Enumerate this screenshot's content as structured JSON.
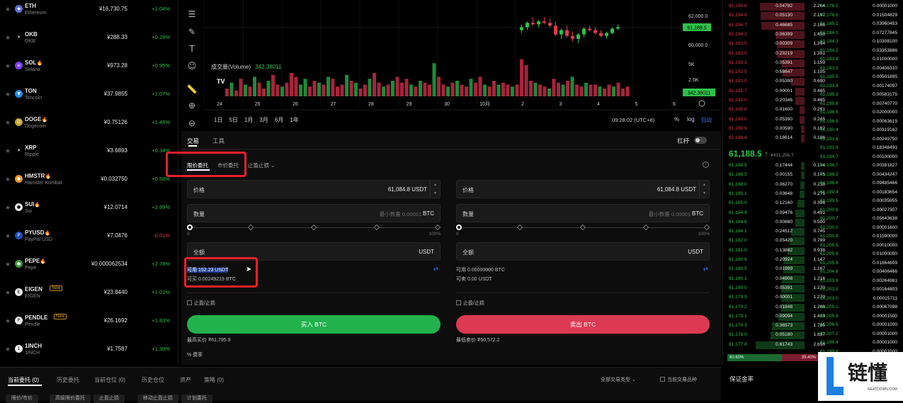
{
  "coins": [
    {
      "sym": "ETH",
      "name": "Ethereum",
      "price": "¥16,730.75",
      "chg": "+1.04%",
      "dir": "up",
      "color": "#5a6fd8",
      "glyph": "◆",
      "fire": false,
      "isnew": false
    },
    {
      "sym": "OKB",
      "name": "OKB",
      "price": "¥288.33",
      "chg": "+0.29%",
      "dir": "up",
      "color": "#000",
      "glyph": "✕",
      "fire": false,
      "isnew": false
    },
    {
      "sym": "SOL",
      "name": "Solana",
      "price": "¥973.28",
      "chg": "+0.95%",
      "dir": "up",
      "color": "#7b3fe4",
      "glyph": "≡",
      "fire": true,
      "isnew": false
    },
    {
      "sym": "TON",
      "name": "Toncoin",
      "price": "¥37.9855",
      "chg": "+1.07%",
      "dir": "up",
      "color": "#1f8ce6",
      "glyph": "▼",
      "fire": false,
      "isnew": false
    },
    {
      "sym": "DOGE",
      "name": "Dogecoin",
      "price": "¥0.75126",
      "chg": "+1.46%",
      "dir": "up",
      "color": "#c2a633",
      "glyph": "D",
      "fire": true,
      "isnew": false
    },
    {
      "sym": "XRP",
      "name": "Ripple",
      "price": "¥3.6893",
      "chg": "+0.34%",
      "dir": "up",
      "color": "#000",
      "glyph": "✕",
      "fire": false,
      "isnew": false
    },
    {
      "sym": "HMSTR",
      "name": "Hamster Kombat",
      "price": "¥0.032750",
      "chg": "+0.50%",
      "dir": "up",
      "color": "#e8952a",
      "glyph": "●",
      "fire": true,
      "isnew": false
    },
    {
      "sym": "SUI",
      "name": "Sui",
      "price": "¥12.0714",
      "chg": "+2.99%",
      "dir": "up",
      "color": "#eaeaea",
      "glyph": "●",
      "fire": true,
      "isnew": false
    },
    {
      "sym": "PYUSD",
      "name": "PayPal USD",
      "price": "¥7.0476",
      "chg": "-0.01%",
      "dir": "dn",
      "color": "#1d4fb8",
      "glyph": "P",
      "fire": true,
      "isnew": false
    },
    {
      "sym": "PEPE",
      "name": "Pepe",
      "price": "¥0.000062534",
      "chg": "+2.78%",
      "dir": "up",
      "color": "#3b9b3b",
      "glyph": "●",
      "fire": true,
      "isnew": false
    },
    {
      "sym": "EIGEN",
      "name": "EIGEN",
      "price": "¥23.8440",
      "chg": "+1.01%",
      "dir": "up",
      "color": "#eaeaea",
      "glyph": "E",
      "fire": false,
      "isnew": true
    },
    {
      "sym": "PENDLE",
      "name": "Pendle",
      "price": "¥26.1692",
      "chg": "+1.83%",
      "dir": "up",
      "color": "#eaeaea",
      "glyph": "P",
      "fire": false,
      "isnew": true
    },
    {
      "sym": "1INCH",
      "name": "1INCH",
      "price": "¥1.7587",
      "chg": "+1.30%",
      "dir": "up",
      "color": "#eaeaea",
      "glyph": "1",
      "fire": false,
      "isnew": false
    }
  ],
  "new_badge": "New",
  "chart": {
    "price_labels": [
      "62,000.0",
      "61,188.5",
      "60,000.0"
    ],
    "current_price": "61,188.5",
    "volume_title": "成交量(Volume)",
    "volume_value": "342.38011",
    "vol_ticks": [
      "5K",
      "2.5K"
    ],
    "vol_current": "342.38011",
    "x_ticks": [
      "24",
      "25",
      "26",
      "27",
      "28",
      "29",
      "30",
      "10月",
      "2",
      "3",
      "4",
      "5",
      "6"
    ],
    "ranges": [
      "1日",
      "5日",
      "1月",
      "3月",
      "6月",
      "1年"
    ],
    "clock": "09:28:02 (UTC+8)",
    "pct_btn": "%",
    "log_btn": "log",
    "auto_btn": "自动",
    "tv_mark": "TV",
    "candles": [
      [
        61000,
        61400,
        60800,
        61200
      ],
      [
        61200,
        61600,
        61000,
        61500
      ],
      [
        61500,
        61900,
        61300,
        61400
      ],
      [
        61400,
        61700,
        61200,
        61600
      ],
      [
        61600,
        61900,
        61400,
        61500
      ],
      [
        61500,
        61800,
        61200,
        61300
      ],
      [
        61300,
        61600,
        60600,
        60700
      ],
      [
        60700,
        61100,
        60400,
        61000
      ],
      [
        61000,
        61300,
        60500,
        60600
      ],
      [
        60600,
        60900,
        60200,
        60400
      ],
      [
        60400,
        60800,
        60100,
        60700
      ],
      [
        60700,
        61200,
        60500,
        61100
      ],
      [
        61100,
        61300,
        60900,
        61000
      ],
      [
        61000,
        61200,
        60700,
        60800
      ],
      [
        60800,
        61000,
        60500,
        60600
      ],
      [
        60600,
        60900,
        60400,
        60800
      ],
      [
        60800,
        61200,
        60700,
        61100
      ],
      [
        61100,
        61400,
        61000,
        61200
      ]
    ],
    "volumes": [
      0.2,
      0.35,
      0.15,
      0.45,
      0.3,
      0.25,
      0.5,
      0.35,
      0.2,
      0.4,
      0.55,
      0.3,
      0.25,
      0.35,
      0.6,
      0.5,
      0.3,
      0.45,
      0.25,
      0.4,
      0.35,
      0.3,
      0.5,
      0.45,
      0.25,
      0.3,
      0.55,
      0.4,
      0.35,
      0.2,
      0.3,
      0.45,
      0.6,
      0.35,
      0.25,
      0.3,
      0.4,
      0.5,
      0.35,
      0.45,
      0.3,
      0.25,
      0.4,
      0.35,
      0.3,
      0.85,
      0.5,
      0.3,
      0.25,
      0.35,
      0.4,
      0.3,
      0.25,
      0.45,
      0.35,
      0.5,
      0.3,
      0.25,
      0.4,
      0.3,
      0.35,
      0.3,
      0.25,
      0.3,
      0.95,
      0.8,
      0.4,
      0.35,
      0.3,
      0.25,
      0.2,
      0.45,
      0.35,
      0.3,
      0.4,
      0.5,
      0.3,
      0.25,
      0.35,
      0.3,
      0.3,
      0.25,
      0.2,
      0.3,
      0.25,
      0.35,
      0.2,
      0.25
    ],
    "vol_colors": "rgrrgrgrrgrrgrrrggrrgrgrrrgrgrrgrrgrgrrrgrgrrgrrgrgrrgrrgrrgrrgrrrrgrrgrrgrgrrgrrgrrgrr"
  },
  "trade": {
    "tab_trade": "交易",
    "tab_tools": "工具",
    "leverage": "杠杆",
    "order_types": [
      "限价委托",
      "市价委托",
      "止盈止损"
    ],
    "buy": {
      "price_label": "价格",
      "price": "61,084.8",
      "unit": "USDT",
      "qty_label": "数量",
      "qty_ph": "最小数量 0.00001",
      "qty_unit": "BTC",
      "total_label": "全额",
      "total_unit": "USDT",
      "avail": "可用 152.23 USDT",
      "can": "可买 0.00249219 BTC",
      "tpsl": "止盈/止损",
      "btn": "买入 BTC",
      "limit": "最高买价 ₮61,795.9",
      "fee": "费率"
    },
    "sell": {
      "price_label": "价格",
      "price": "61,084.8",
      "unit": "USDT",
      "qty_label": "数量",
      "qty_ph": "最小数量 0.00001",
      "qty_unit": "BTC",
      "total_label": "全额",
      "total_unit": "USDT",
      "avail": "可用 0.00000000 BTC",
      "can": "可卖 0.00 USDT",
      "tpsl": "止盈/止损",
      "btn": "卖出 BTC",
      "limit": "最低卖价 ₮60,572.2"
    },
    "slider_min": "0",
    "slider_max": "100%",
    "buy_color": "#22b24c",
    "sell_color": "#dc3a52"
  },
  "orderbook": {
    "asks": [
      [
        "61,194.8",
        "0.04782",
        "2.264"
      ],
      [
        "61,194.6",
        "0.05130",
        "2.197"
      ],
      [
        "61,194.7",
        "0.46685",
        "2.166"
      ],
      [
        "61,194.2",
        "0.06399",
        "1.458"
      ],
      [
        "61,193.5",
        "0.00309",
        "1.394"
      ],
      [
        "61,193.5",
        "0.23219",
        "1.391"
      ],
      [
        "61,193.3",
        "0.05391",
        "1.159"
      ],
      [
        "61,192.5",
        "0.58647",
        "1.105"
      ],
      [
        "61,192.0",
        "0.05390",
        "0.690"
      ],
      [
        "61,191.7",
        "0.00001",
        "0.465"
      ],
      [
        "61,191.0",
        "0.20346",
        "0.465"
      ],
      [
        "61,190.6",
        "0.01600",
        "0.261"
      ],
      [
        "61,190.0",
        "0.05390",
        "0.245"
      ],
      [
        "61,189.9",
        "0.00590",
        "0.192"
      ],
      [
        "61,188.6",
        "0.18614",
        "0.186"
      ]
    ],
    "mid_price": "61,188.5",
    "mid_fiat": "¥431,256.7",
    "bids": [
      [
        "61,188.5",
        "0.17444",
        "0.174"
      ],
      [
        "61,188.5",
        "0.00155",
        "0.175"
      ],
      [
        "61,188.0",
        "0.06270",
        "0.238"
      ],
      [
        "61,185.1",
        "0.03648",
        "0.275"
      ],
      [
        "61,185.0",
        "0.12160",
        "0.396"
      ],
      [
        "61,184.9",
        "0.09476",
        "0.491"
      ],
      [
        "61,184.6",
        "0.00880",
        "0.500"
      ],
      [
        "61,184.1",
        "0.24512",
        "0.745"
      ],
      [
        "61,182.0",
        "0.05420",
        "0.799"
      ],
      [
        "61,181.0",
        "0.13882",
        "0.938"
      ],
      [
        "61,180.6",
        "0.20924",
        "1.147"
      ],
      [
        "61,180.5",
        "0.01999",
        "1.167"
      ],
      [
        "61,180.1",
        "0.04908",
        "1.216"
      ],
      [
        "61,180.0",
        "0.05391",
        "1.270"
      ],
      [
        "61,179.9",
        "0.00001",
        "1.270"
      ],
      [
        "61,179.2",
        "0.01848",
        "1.288"
      ],
      [
        "61,179.1",
        "0.09094",
        "1.419"
      ],
      [
        "61,178.3",
        "0.36573",
        "1.785"
      ],
      [
        "61,178.0",
        "0.05180",
        "1.837"
      ],
      [
        "61,177.8",
        "0.81743",
        "2.656"
      ]
    ],
    "col2_prices": [
      "61,176.1",
      "61,176.0",
      "61,185.1",
      "61,184.1",
      "61,184.3",
      "61,184.2",
      "61,183.8",
      "61,183.5",
      "61,185.5",
      "61,193.4",
      "61,195.3",
      "61,195.6",
      "61,196.5",
      "61,196.9",
      "61,190.4",
      "61,191.6",
      "61,191.9",
      "61,194.7",
      "61,196.7",
      "61,198.3",
      "61,198.6",
      "61,199.4",
      "61,199.5",
      "61,200.6",
      "61,200.7",
      "61,200.0",
      "61,200.8",
      "61,205.5",
      "61,205.9",
      "61,205.9",
      "61,204.8",
      "61,203.9",
      "61,203.5",
      "61,203.0",
      "61,205.1",
      "61,205.9",
      "61,206.5",
      "61,207.2",
      "61,199.4",
      "61,199.8"
    ],
    "col2_amts": [
      "0.00001000",
      "0.01504829",
      "0.03960453",
      "0.07277845",
      "0.10308100",
      "0.03353886",
      "0.01000000",
      "0.00406310",
      "0.00501895",
      "0.00174097",
      "0.00583175",
      "0.00740770",
      "0.02000000",
      "0.00063619",
      "0.00319162",
      "0.00249750",
      "0.18348491",
      "0.00100000",
      "0.00381827",
      "0.00434247",
      "0.09485466",
      "0.00183654",
      "0.00035955",
      "0.00027307",
      "0.05643638",
      "0.00001600",
      "0.01590000",
      "0.00010000",
      "0.01000000",
      "0.01864609",
      "0.00406466",
      "0.00264981",
      "0.00164803",
      "0.00015711",
      "0.00067098",
      "0.00001500",
      "0.00001000",
      "0.00001000",
      "0.00001000",
      "0.00001000"
    ],
    "buy_pct": "60.60%",
    "sell_pct": "39.40%"
  },
  "bottom": {
    "tabs": [
      "当前委托 (0)",
      "历史委托",
      "当前仓位 (0)",
      "历史仓位",
      "资产",
      "策略 (0)"
    ],
    "filter": "全部交易类型",
    "checkbox": "当前交易品种",
    "side_title": "保证金率",
    "pills": [
      "限价/市价",
      "高级限价委托",
      "止盈止损",
      "移动止盈止损",
      "计划委托"
    ]
  },
  "logo": {
    "text": "链懂",
    "sub": "NEATDOWN.COM"
  }
}
